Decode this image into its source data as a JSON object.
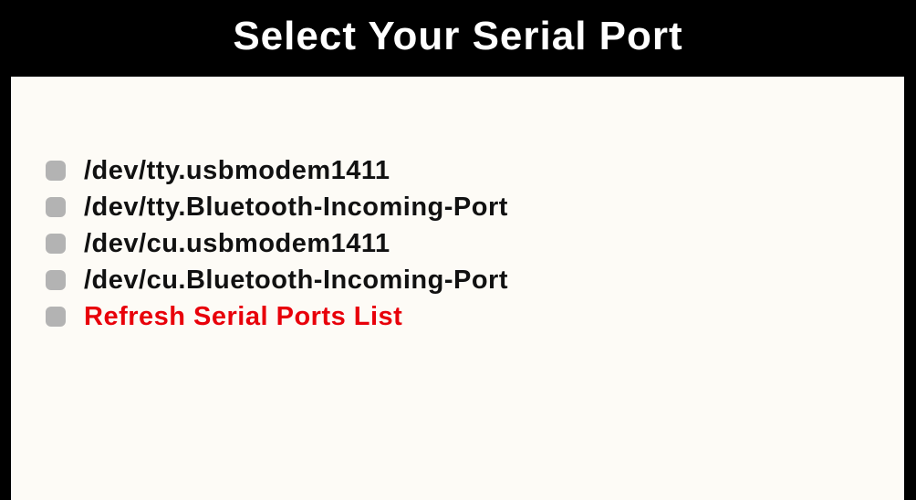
{
  "header": {
    "title": "Select Your Serial Port"
  },
  "ports": [
    {
      "label": "/dev/tty.usbmodem1411"
    },
    {
      "label": "/dev/tty.Bluetooth-Incoming-Port"
    },
    {
      "label": "/dev/cu.usbmodem1411"
    },
    {
      "label": "/dev/cu.Bluetooth-Incoming-Port"
    }
  ],
  "refresh": {
    "label": "Refresh Serial Ports List"
  },
  "colors": {
    "background": "#000000",
    "panel": "#fdfbf6",
    "text": "#111111",
    "refresh_text": "#e8000a",
    "bullet": "#b3b3b3",
    "title_text": "#ffffff"
  }
}
